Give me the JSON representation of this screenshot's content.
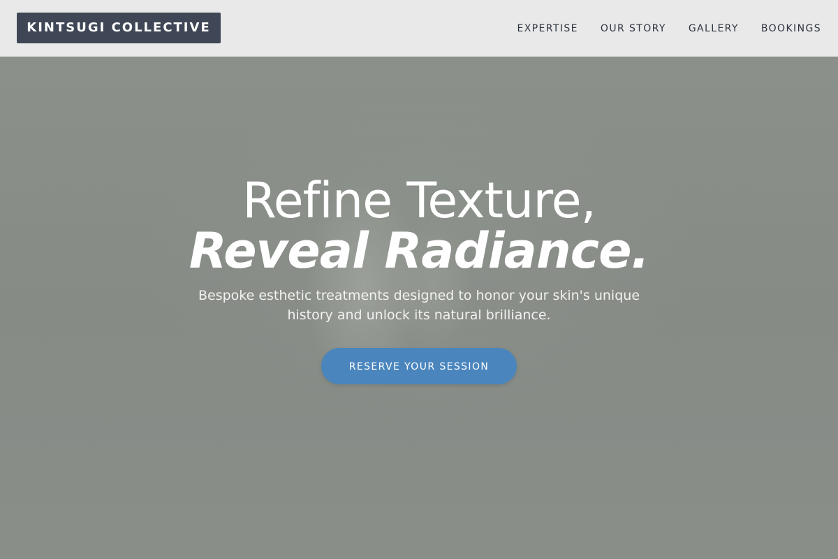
{
  "brand": {
    "name": "KINTSUGI COLLECTIVE"
  },
  "nav": {
    "items": [
      {
        "label": "EXPERTISE"
      },
      {
        "label": "OUR STORY"
      },
      {
        "label": "GALLERY"
      },
      {
        "label": "BOOKINGS"
      }
    ]
  },
  "hero": {
    "headline_line1": "Refine Texture,",
    "headline_line2": "Reveal Radiance.",
    "subtitle": "Bespoke esthetic treatments designed to honor your skin's unique history and unlock its natural brilliance.",
    "cta_label": "RESERVE YOUR SESSION"
  },
  "colors": {
    "header_bg": "#e9e9e9",
    "logo_bg": "#3f4756",
    "nav_text": "#2e3440",
    "hero_bg": "#8b8f8a",
    "cta_bg": "#4a85bd"
  }
}
